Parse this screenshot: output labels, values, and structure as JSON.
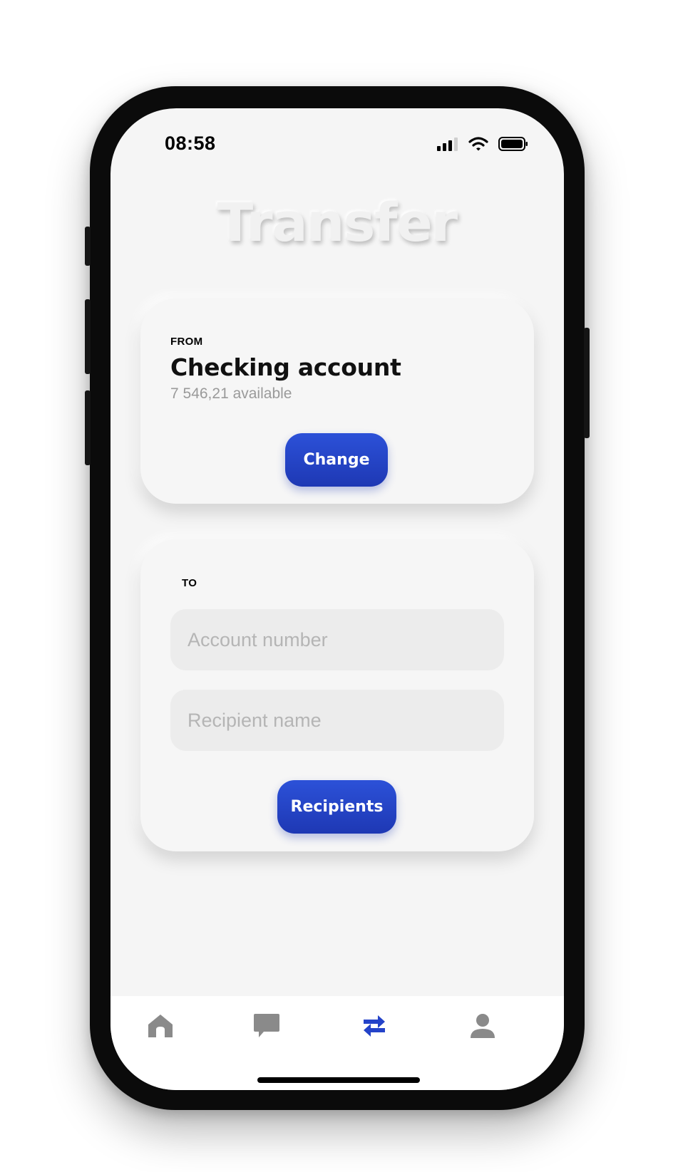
{
  "status_bar": {
    "time": "08:58"
  },
  "header": {
    "title": "Transfer"
  },
  "from_card": {
    "label": "FROM",
    "account_name": "Checking account",
    "available": "7 546,21 available",
    "change_button": "Change"
  },
  "to_card": {
    "label": "TO",
    "account_number_placeholder": "Account number",
    "recipient_name_placeholder": "Recipient name",
    "recipients_button": "Recipients"
  },
  "tab_bar": {
    "tabs": [
      {
        "icon": "home-icon",
        "active": false
      },
      {
        "icon": "chat-icon",
        "active": false
      },
      {
        "icon": "transfer-icon",
        "active": true
      },
      {
        "icon": "profile-icon",
        "active": false
      }
    ]
  },
  "colors": {
    "accent": "#2443C9",
    "inactive_icon": "#8a8a8a",
    "background": "#f5f5f5"
  }
}
